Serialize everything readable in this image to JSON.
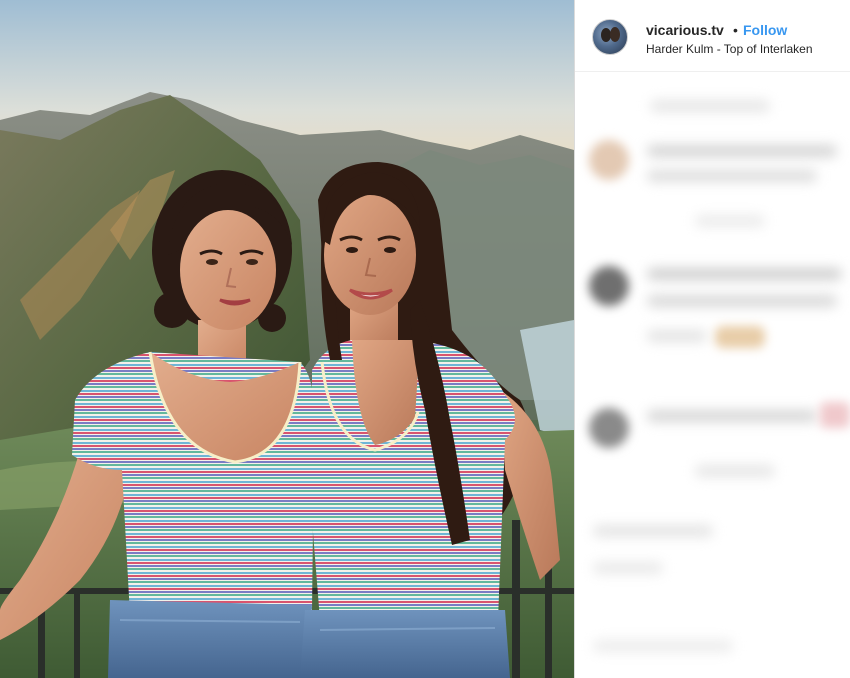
{
  "post": {
    "username": "vicarious.tv",
    "separator": "•",
    "follow_label": "Follow",
    "location": "Harder Kulm - Top of Interlaken"
  },
  "photo": {
    "scene": "mountain-lake-overlook"
  },
  "comments": {
    "blurred": true
  },
  "colors": {
    "follow_blue": "#3897f0",
    "text": "#262626",
    "divider": "#dbdbdb"
  }
}
